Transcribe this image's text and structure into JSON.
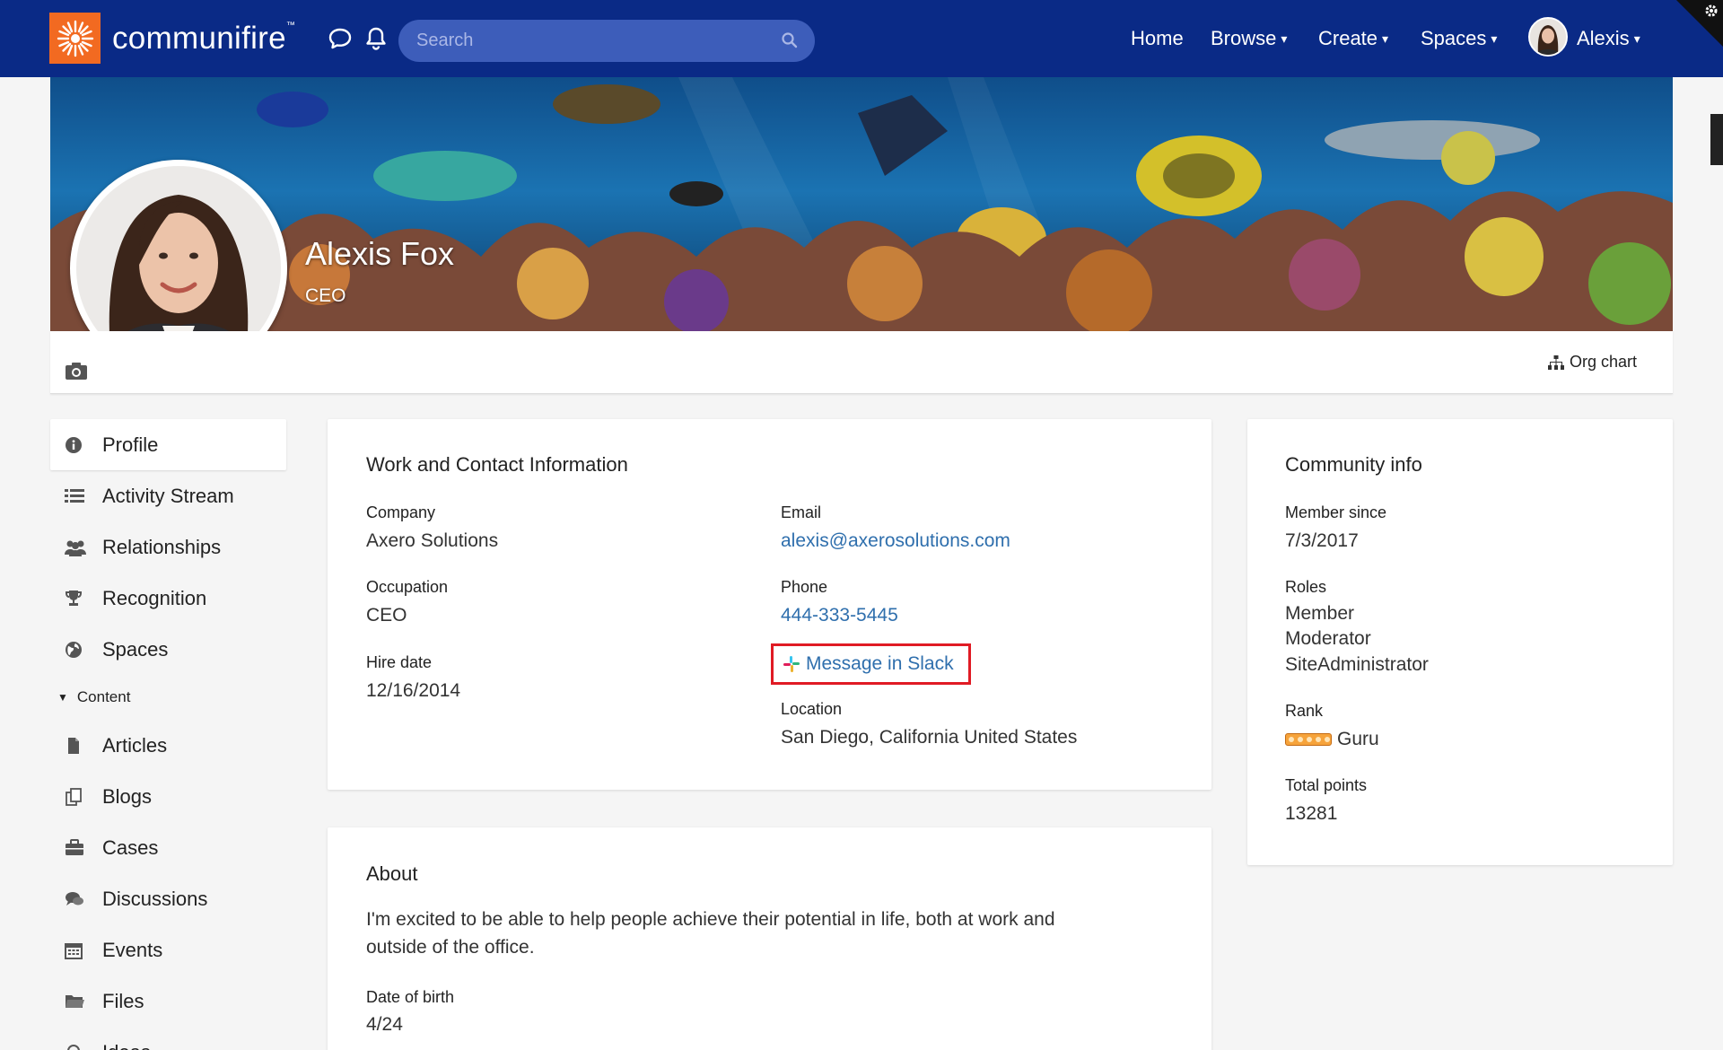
{
  "header": {
    "logo_text": "communifire",
    "logo_tm": "™",
    "search_placeholder": "Search",
    "nav": {
      "home": "Home",
      "browse": "Browse",
      "create": "Create",
      "spaces": "Spaces",
      "user": "Alexis"
    },
    "caret": "▾"
  },
  "hero": {
    "name": "Alexis Fox",
    "title": "CEO",
    "org_chart": "Org chart"
  },
  "sidebar": {
    "items": [
      {
        "label": "Profile",
        "icon": "info-icon"
      },
      {
        "label": "Activity Stream",
        "icon": "list-icon"
      },
      {
        "label": "Relationships",
        "icon": "users-icon"
      },
      {
        "label": "Recognition",
        "icon": "trophy-icon"
      },
      {
        "label": "Spaces",
        "icon": "globe-icon"
      }
    ],
    "section_label": "Content",
    "content_items": [
      {
        "label": "Articles",
        "icon": "file-icon"
      },
      {
        "label": "Blogs",
        "icon": "blogs-icon"
      },
      {
        "label": "Cases",
        "icon": "briefcase-icon"
      },
      {
        "label": "Discussions",
        "icon": "comments-icon"
      },
      {
        "label": "Events",
        "icon": "calendar-icon"
      },
      {
        "label": "Files",
        "icon": "folder-icon"
      },
      {
        "label": "Ideas",
        "icon": "lightbulb-icon"
      }
    ]
  },
  "work": {
    "heading": "Work and Contact Information",
    "company_label": "Company",
    "company_value": "Axero Solutions",
    "occupation_label": "Occupation",
    "occupation_value": "CEO",
    "hire_label": "Hire date",
    "hire_value": "12/16/2014",
    "email_label": "Email",
    "email_value": "alexis@axerosolutions.com",
    "phone_label": "Phone",
    "phone_value": "444-333-5445",
    "slack_label": "Message in Slack",
    "location_label": "Location",
    "location_value": "San Diego, California United States"
  },
  "about": {
    "heading": "About",
    "text_line1": "I'm excited to be able to help people achieve their potential in life, both at work and",
    "text_line2": "outside of the office.",
    "dob_label": "Date of birth",
    "dob_value": "4/24"
  },
  "community": {
    "heading": "Community info",
    "member_since_label": "Member since",
    "member_since_value": "7/3/2017",
    "roles_label": "Roles",
    "roles": [
      "Member",
      "Moderator",
      "SiteAdministrator"
    ],
    "rank_label": "Rank",
    "rank_value": "Guru",
    "points_label": "Total points",
    "points_value": "13281"
  },
  "colors": {
    "header_bg": "#0a2a86",
    "logo_orange": "#f26a21",
    "link": "#2f6fad",
    "highlight_red": "#e01b24"
  }
}
